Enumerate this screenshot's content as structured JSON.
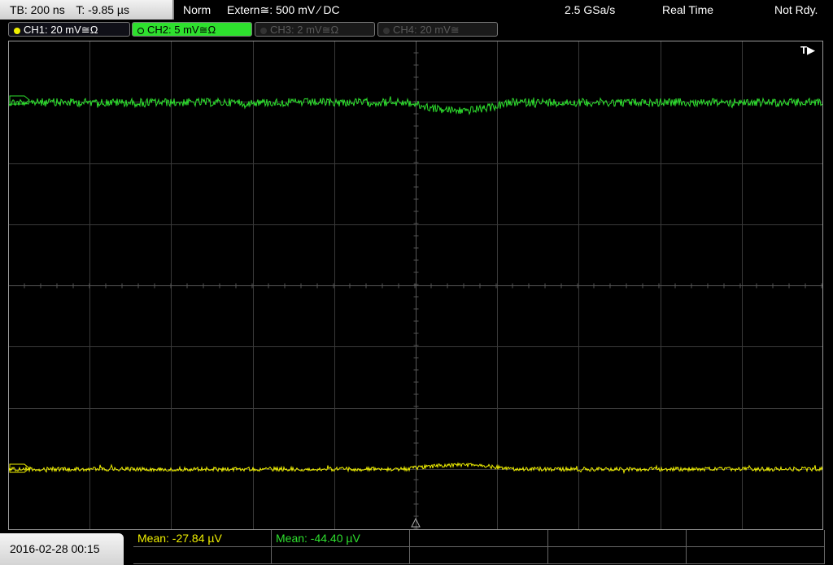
{
  "header": {
    "timebase": "TB: 200 ns",
    "trigger_time": "T: -9.85 µs",
    "trigger_mode": "Norm",
    "trigger_source": "Extern≅: 500 mV ⁄ DC",
    "sample_rate": "2.5 GSa/s",
    "acq_mode": "Real Time",
    "state": "Not Rdy."
  },
  "channels": [
    {
      "label": "CH1: 20 mV≅Ω",
      "color": "#f0f000",
      "active": true
    },
    {
      "label": "CH2: 5 mV≅Ω",
      "color": "#2ee02e",
      "active": true
    },
    {
      "label": "CH3: 2 mV≅Ω",
      "color": "#5a5a5a",
      "active": false
    },
    {
      "label": "CH4: 20 mV≅",
      "color": "#5a5a5a",
      "active": false
    }
  ],
  "trigger_marker": "T▶",
  "datetime": "2016-02-28  00:15",
  "measurements": [
    {
      "text": "Mean: -27.84 µV",
      "color": "#f0f000"
    },
    {
      "text": "Mean: -44.40 µV",
      "color": "#2ee02e"
    }
  ],
  "colors": {
    "ch1": "#f0f000",
    "ch2": "#2ee02e",
    "grid": "#444444"
  }
}
